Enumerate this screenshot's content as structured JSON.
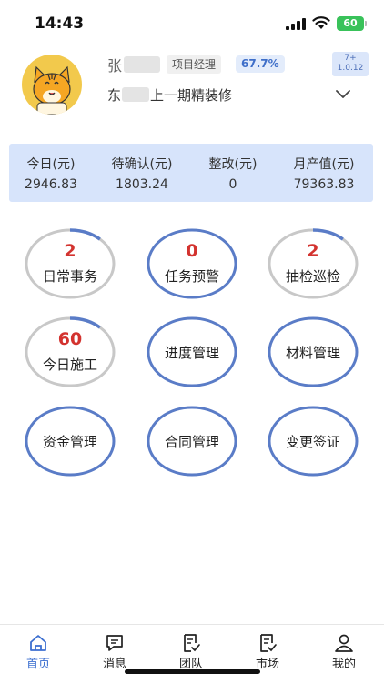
{
  "status_bar": {
    "time": "14:43",
    "battery": "60"
  },
  "profile": {
    "name": "张",
    "role": "项目经理",
    "percent": "67.7%",
    "version_line1": "7+",
    "version_line2": "1.0.12",
    "project_prefix": "东",
    "project_name": "上一期精装修"
  },
  "stats": [
    {
      "label": "今日(元)",
      "value": "2946.83"
    },
    {
      "label": "待确认(元)",
      "value": "1803.24"
    },
    {
      "label": "整改(元)",
      "value": "0"
    },
    {
      "label": "月产值(元)",
      "value": "79363.83"
    }
  ],
  "modules": [
    {
      "label": "日常事务",
      "count": "2",
      "progress": 0.12
    },
    {
      "label": "任务预警",
      "count": "0",
      "progress": 1.0
    },
    {
      "label": "抽检巡检",
      "count": "2",
      "progress": 0.12
    },
    {
      "label": "今日施工",
      "count": "60",
      "progress": 0.12
    },
    {
      "label": "进度管理",
      "count": "",
      "progress": 1.0
    },
    {
      "label": "材料管理",
      "count": "",
      "progress": 1.0
    },
    {
      "label": "资金管理",
      "count": "",
      "progress": 1.0
    },
    {
      "label": "合同管理",
      "count": "",
      "progress": 1.0
    },
    {
      "label": "变更签证",
      "count": "",
      "progress": 1.0
    }
  ],
  "nav": [
    {
      "label": "首页",
      "icon": "home-icon"
    },
    {
      "label": "消息",
      "icon": "message-icon"
    },
    {
      "label": "团队",
      "icon": "team-icon"
    },
    {
      "label": "市场",
      "icon": "market-icon"
    },
    {
      "label": "我的",
      "icon": "profile-icon"
    }
  ],
  "colors": {
    "accent": "#3c6fd0",
    "ring": "#5a7cc7",
    "ring_track": "#c8c8c8",
    "count": "#d3332f",
    "stats_bg": "#d7e4fb"
  }
}
